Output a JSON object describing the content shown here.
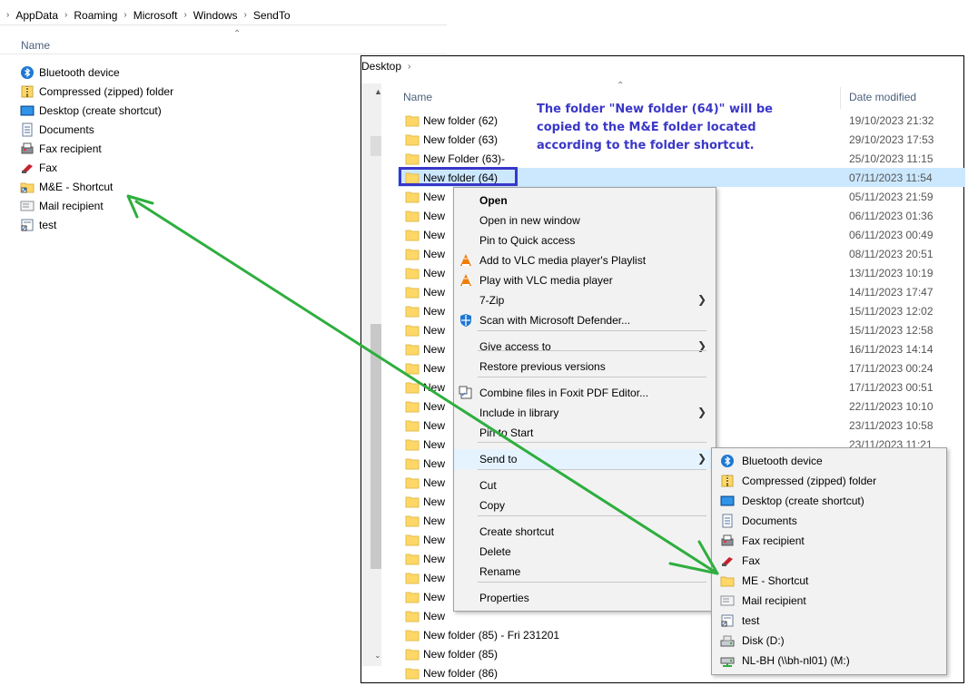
{
  "left_window": {
    "breadcrumb": [
      "AppData",
      "Roaming",
      "Microsoft",
      "Windows",
      "SendTo"
    ],
    "column_name": "Name",
    "items": [
      {
        "label": "Bluetooth device",
        "icon": "bluetooth-icon"
      },
      {
        "label": "Compressed (zipped) folder",
        "icon": "zip-folder-icon"
      },
      {
        "label": "Desktop (create shortcut)",
        "icon": "desktop-icon"
      },
      {
        "label": "Documents",
        "icon": "document-icon"
      },
      {
        "label": "Fax recipient",
        "icon": "fax-icon"
      },
      {
        "label": "Fax",
        "icon": "fax-red-icon"
      },
      {
        "label": "M&E - Shortcut",
        "icon": "folder-shortcut-icon"
      },
      {
        "label": "Mail recipient",
        "icon": "mail-icon"
      },
      {
        "label": "test",
        "icon": "shortcut-icon"
      }
    ]
  },
  "right_window": {
    "breadcrumb": "Desktop",
    "column_name": "Name",
    "column_date": "Date modified",
    "files": [
      {
        "name": "New folder (62)",
        "date": "19/10/2023 21:32"
      },
      {
        "name": "New folder (63)",
        "date": "29/10/2023 17:53"
      },
      {
        "name": "New Folder (63)-",
        "date": "25/10/2023 11:15"
      },
      {
        "name": "New folder (64)",
        "date": "07/11/2023 11:54",
        "selected": true
      },
      {
        "name": "New",
        "date": "05/11/2023 21:59"
      },
      {
        "name": "New",
        "date": "06/11/2023 01:36"
      },
      {
        "name": "New",
        "date": "06/11/2023 00:49"
      },
      {
        "name": "New",
        "date": "08/11/2023 20:51"
      },
      {
        "name": "New",
        "date": "13/11/2023 10:19"
      },
      {
        "name": "New",
        "date": "14/11/2023 17:47"
      },
      {
        "name": "New",
        "date": "15/11/2023 12:02"
      },
      {
        "name": "New",
        "date": "15/11/2023 12:58"
      },
      {
        "name": "New",
        "date": "16/11/2023 14:14"
      },
      {
        "name": "New",
        "date": "17/11/2023 00:24"
      },
      {
        "name": "New",
        "date": "17/11/2023 00:51"
      },
      {
        "name": "New",
        "date": "22/11/2023 10:10"
      },
      {
        "name": "New",
        "date": "23/11/2023 10:58"
      },
      {
        "name": "New",
        "date": "23/11/2023 11:21"
      },
      {
        "name": "New",
        "date": ""
      },
      {
        "name": "New",
        "date": ""
      },
      {
        "name": "New",
        "date": ""
      },
      {
        "name": "New",
        "date": ""
      },
      {
        "name": "New",
        "date": ""
      },
      {
        "name": "New",
        "date": ""
      },
      {
        "name": "New",
        "date": ""
      },
      {
        "name": "New",
        "date": ""
      },
      {
        "name": "New",
        "date": ""
      },
      {
        "name": "New folder (85) - Fri 231201",
        "date": ""
      },
      {
        "name": "New folder (85)",
        "date": ""
      },
      {
        "name": "New folder (86)",
        "date": ""
      }
    ]
  },
  "annotation": "The folder \"New folder (64)\" will be copied to the M&E folder located according to the folder shortcut.",
  "context_menu": {
    "items": [
      {
        "label": "Open",
        "bold": true
      },
      {
        "label": "Open in new window"
      },
      {
        "label": "Pin to Quick access"
      },
      {
        "label": "Add to VLC media player's Playlist",
        "icon": "vlc-icon"
      },
      {
        "label": "Play with VLC media player",
        "icon": "vlc-icon"
      },
      {
        "label": "7-Zip",
        "submenu": true
      },
      {
        "label": "Scan with Microsoft Defender...",
        "icon": "defender-icon"
      },
      {
        "label": "Give access to",
        "submenu": true
      },
      {
        "label": "Restore previous versions"
      },
      {
        "label": "Combine files in Foxit PDF Editor...",
        "icon": "foxit-icon"
      },
      {
        "label": "Include in library",
        "submenu": true
      },
      {
        "label": "Pin to Start"
      },
      {
        "label": "Send to",
        "submenu": true
      },
      {
        "label": "Cut"
      },
      {
        "label": "Copy"
      },
      {
        "label": "Create shortcut"
      },
      {
        "label": "Delete"
      },
      {
        "label": "Rename"
      },
      {
        "label": "Properties"
      }
    ]
  },
  "send_to_menu": {
    "items": [
      {
        "label": "Bluetooth device",
        "icon": "bluetooth-icon"
      },
      {
        "label": "Compressed (zipped) folder",
        "icon": "zip-folder-icon"
      },
      {
        "label": "Desktop (create shortcut)",
        "icon": "desktop-icon"
      },
      {
        "label": "Documents",
        "icon": "document-icon"
      },
      {
        "label": "Fax recipient",
        "icon": "fax-icon"
      },
      {
        "label": "Fax",
        "icon": "fax-red-icon"
      },
      {
        "label": "ME - Shortcut",
        "icon": "folder-icon"
      },
      {
        "label": "Mail recipient",
        "icon": "mail-icon"
      },
      {
        "label": "test",
        "icon": "shortcut-icon"
      },
      {
        "label": "Disk (D:)",
        "icon": "drive-icon"
      },
      {
        "label": "NL-BH (\\\\bh-nl01) (M:)",
        "icon": "network-drive-icon"
      }
    ]
  },
  "colors": {
    "annotation": "#3a37c8",
    "arrow": "#2eae3e",
    "selection": "#cce8ff",
    "folder": "#ffd766"
  }
}
